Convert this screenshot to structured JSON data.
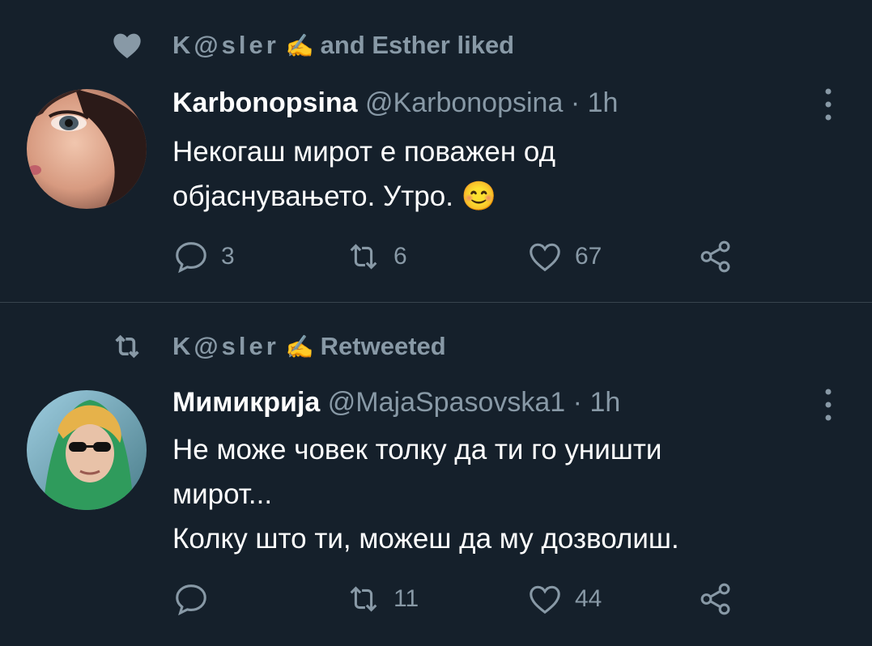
{
  "tweets": [
    {
      "context_icon": "heart-icon",
      "context_user": "K@sler",
      "context_emoji": "✍",
      "context_text": "and Esther liked",
      "display_name": "Karbonopsina",
      "handle": "@Karbonopsina",
      "separator": "·",
      "time": "1h",
      "lines": [
        "Некогаш мирот е поважен од",
        "објаснувањето. Утро. 😊"
      ],
      "actions": {
        "reply_count": "3",
        "retweet_count": "6",
        "like_count": "67"
      }
    },
    {
      "context_icon": "retweet-icon",
      "context_user": "K@sler",
      "context_emoji": "✍",
      "context_text": "Retweeted",
      "display_name": "Мимикрија",
      "handle": "@MajaSpasovska1",
      "separator": "·",
      "time": "1h",
      "lines": [
        "Не може човек толку да ти го уништи",
        "мирот...",
        "Колку што ти, можеш да му дозволиш."
      ],
      "actions": {
        "reply_count": "",
        "retweet_count": "11",
        "like_count": "44"
      }
    }
  ],
  "colors": {
    "background": "#15202b",
    "secondary_text": "#8899a6",
    "divider": "#38444d"
  }
}
